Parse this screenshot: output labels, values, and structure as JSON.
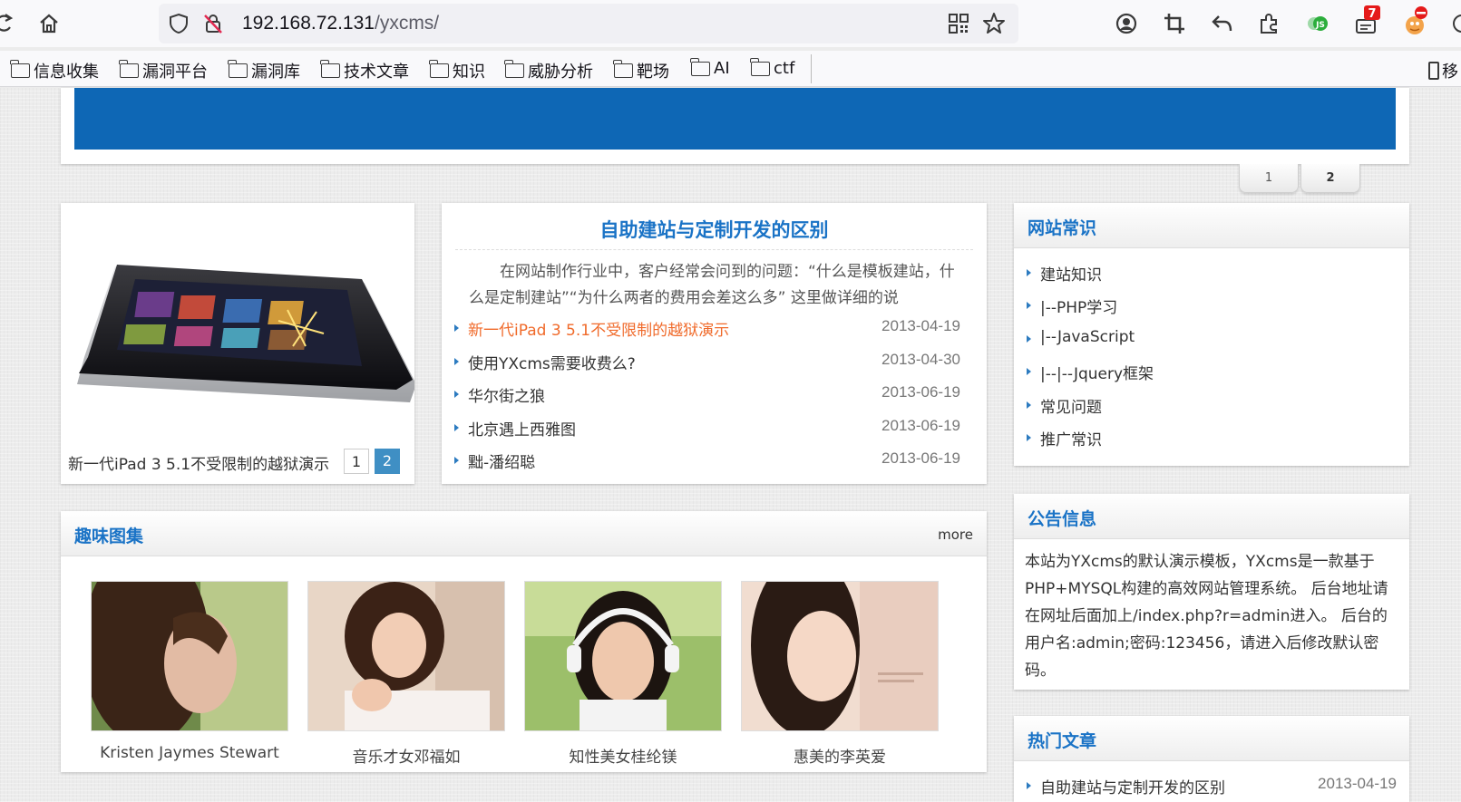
{
  "browser": {
    "url_host": "192.168.72.131",
    "url_path": "/yxcms/",
    "badges": {
      "extension_count": "7",
      "js_ext": "JS"
    },
    "bookmarks": [
      "信息收集",
      "漏洞平台",
      "漏洞库",
      "技术文章",
      "知识",
      "威胁分析",
      "靶场",
      "AI",
      "ctf"
    ],
    "overflow_label": "移"
  },
  "slider": {
    "tabs": [
      "1",
      "2"
    ]
  },
  "focus": {
    "caption": "新一代iPad 3 5.1不受限制的越狱演示",
    "pages": [
      "1",
      "2"
    ]
  },
  "headline": {
    "title": "自助建站与定制开发的区别",
    "summary": "在网站制作行业中，客户经常会问到的问题：“什么是模板建站，什么是定制建站”“为什么两者的费用会差这么多” 这里做详细的说"
  },
  "news": [
    {
      "title": "新一代iPad 3 5.1不受限制的越狱演示",
      "date": "2013-04-19"
    },
    {
      "title": "使用YXcms需要收费么?",
      "date": "2013-04-30"
    },
    {
      "title": "华尔街之狼",
      "date": "2013-06-19"
    },
    {
      "title": "北京遇上西雅图",
      "date": "2013-06-19"
    },
    {
      "title": "黜-潘绍聪",
      "date": "2013-06-19"
    }
  ],
  "knowledge": {
    "heading": "网站常识",
    "items": [
      "建站知识",
      "|--PHP学习",
      "|--JavaScript",
      "|--|--Jquery框架",
      "常见问题",
      "推广常识"
    ]
  },
  "notice": {
    "heading": "公告信息",
    "text": "本站为YXcms的默认演示模板，YXcms是一款基于PHP+MYSQL构建的高效网站管理系统。 后台地址请在网址后面加上/index.php?r=admin进入。 后台的用户名:admin;密码:123456，请进入后修改默认密码。"
  },
  "hot": {
    "heading": "热门文章",
    "items": [
      {
        "title": "自助建站与定制开发的区别",
        "date": "2013-04-19"
      }
    ]
  },
  "gallery": {
    "heading": "趣味图集",
    "more": "more",
    "items": [
      "Kristen Jaymes Stewart",
      "音乐才女邓福如",
      "知性美女桂纶镁",
      "惠美的李英爱"
    ]
  },
  "colors": {
    "accent": "#1a73c6",
    "banner": "#0e67b5",
    "hot_link": "#f06a2a",
    "page_active": "#3f8fc4"
  }
}
